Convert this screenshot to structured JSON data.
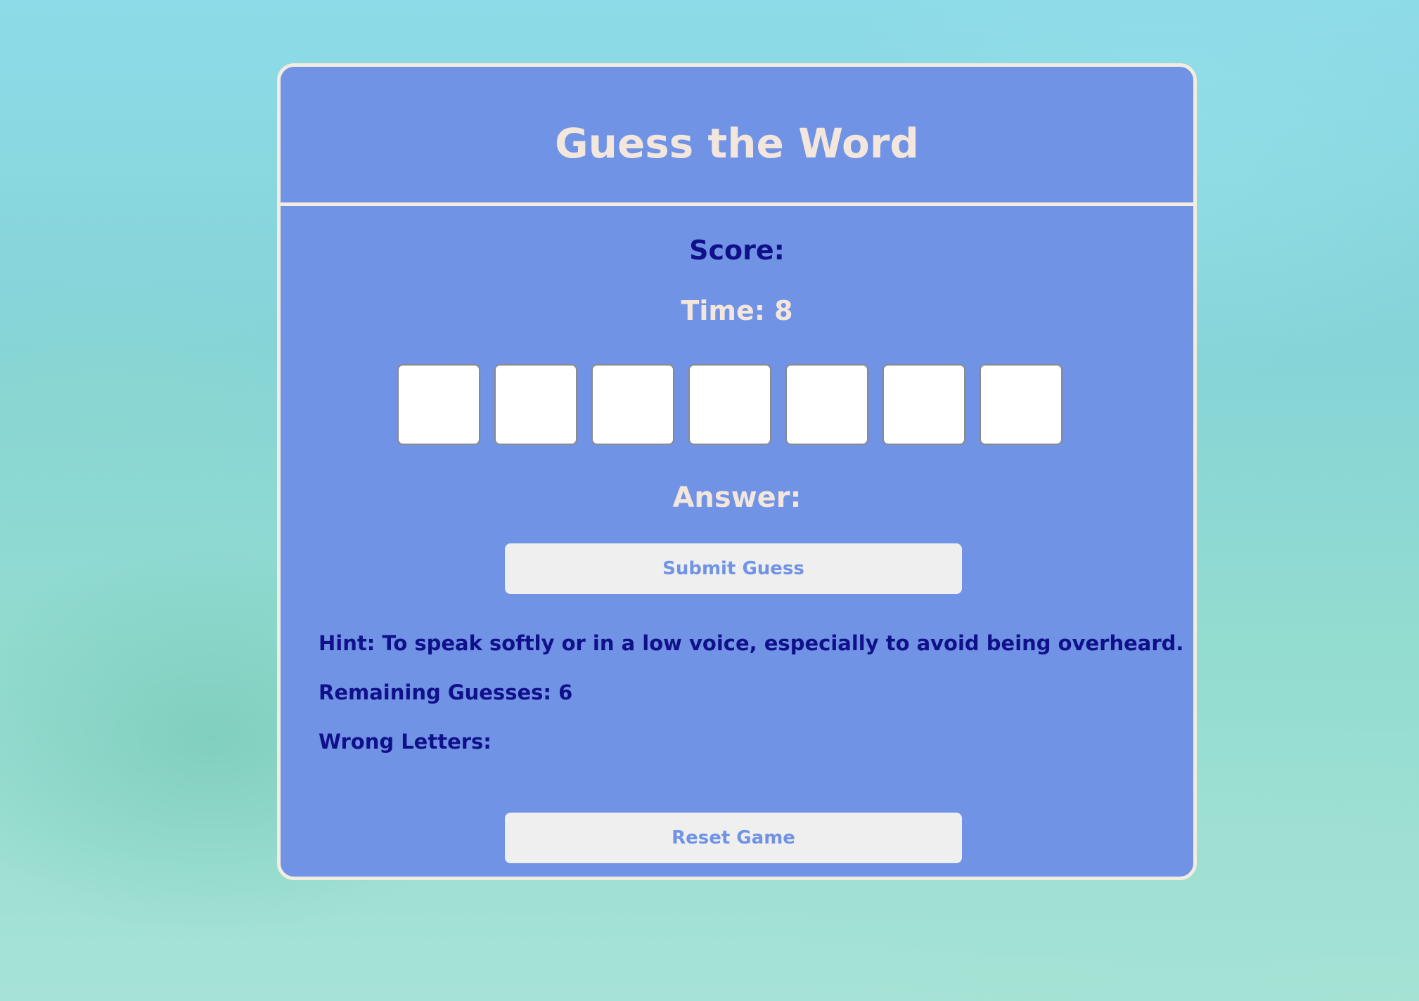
{
  "game": {
    "title": "Guess the Word",
    "score_label": "Score:",
    "time_text": "Time: 8",
    "answer_label": "Answer:",
    "letter_count": 7,
    "letters": [
      "",
      "",
      "",
      "",
      "",
      "",
      ""
    ],
    "submit_label": "Submit Guess",
    "hint_text": "Hint: To speak softly or in a low voice, especially to avoid being overheard.",
    "remaining_text": "Remaining Guesses: 6",
    "wrong_letters_label": "Wrong Letters:",
    "reset_label": "Reset Game"
  },
  "colors": {
    "card_background": "#7093e5",
    "card_border": "#f3ece0",
    "accent_text_light": "#f3e6dc",
    "accent_text_dark": "#10108a",
    "button_background": "#efeff0",
    "button_text": "#7093e5"
  }
}
